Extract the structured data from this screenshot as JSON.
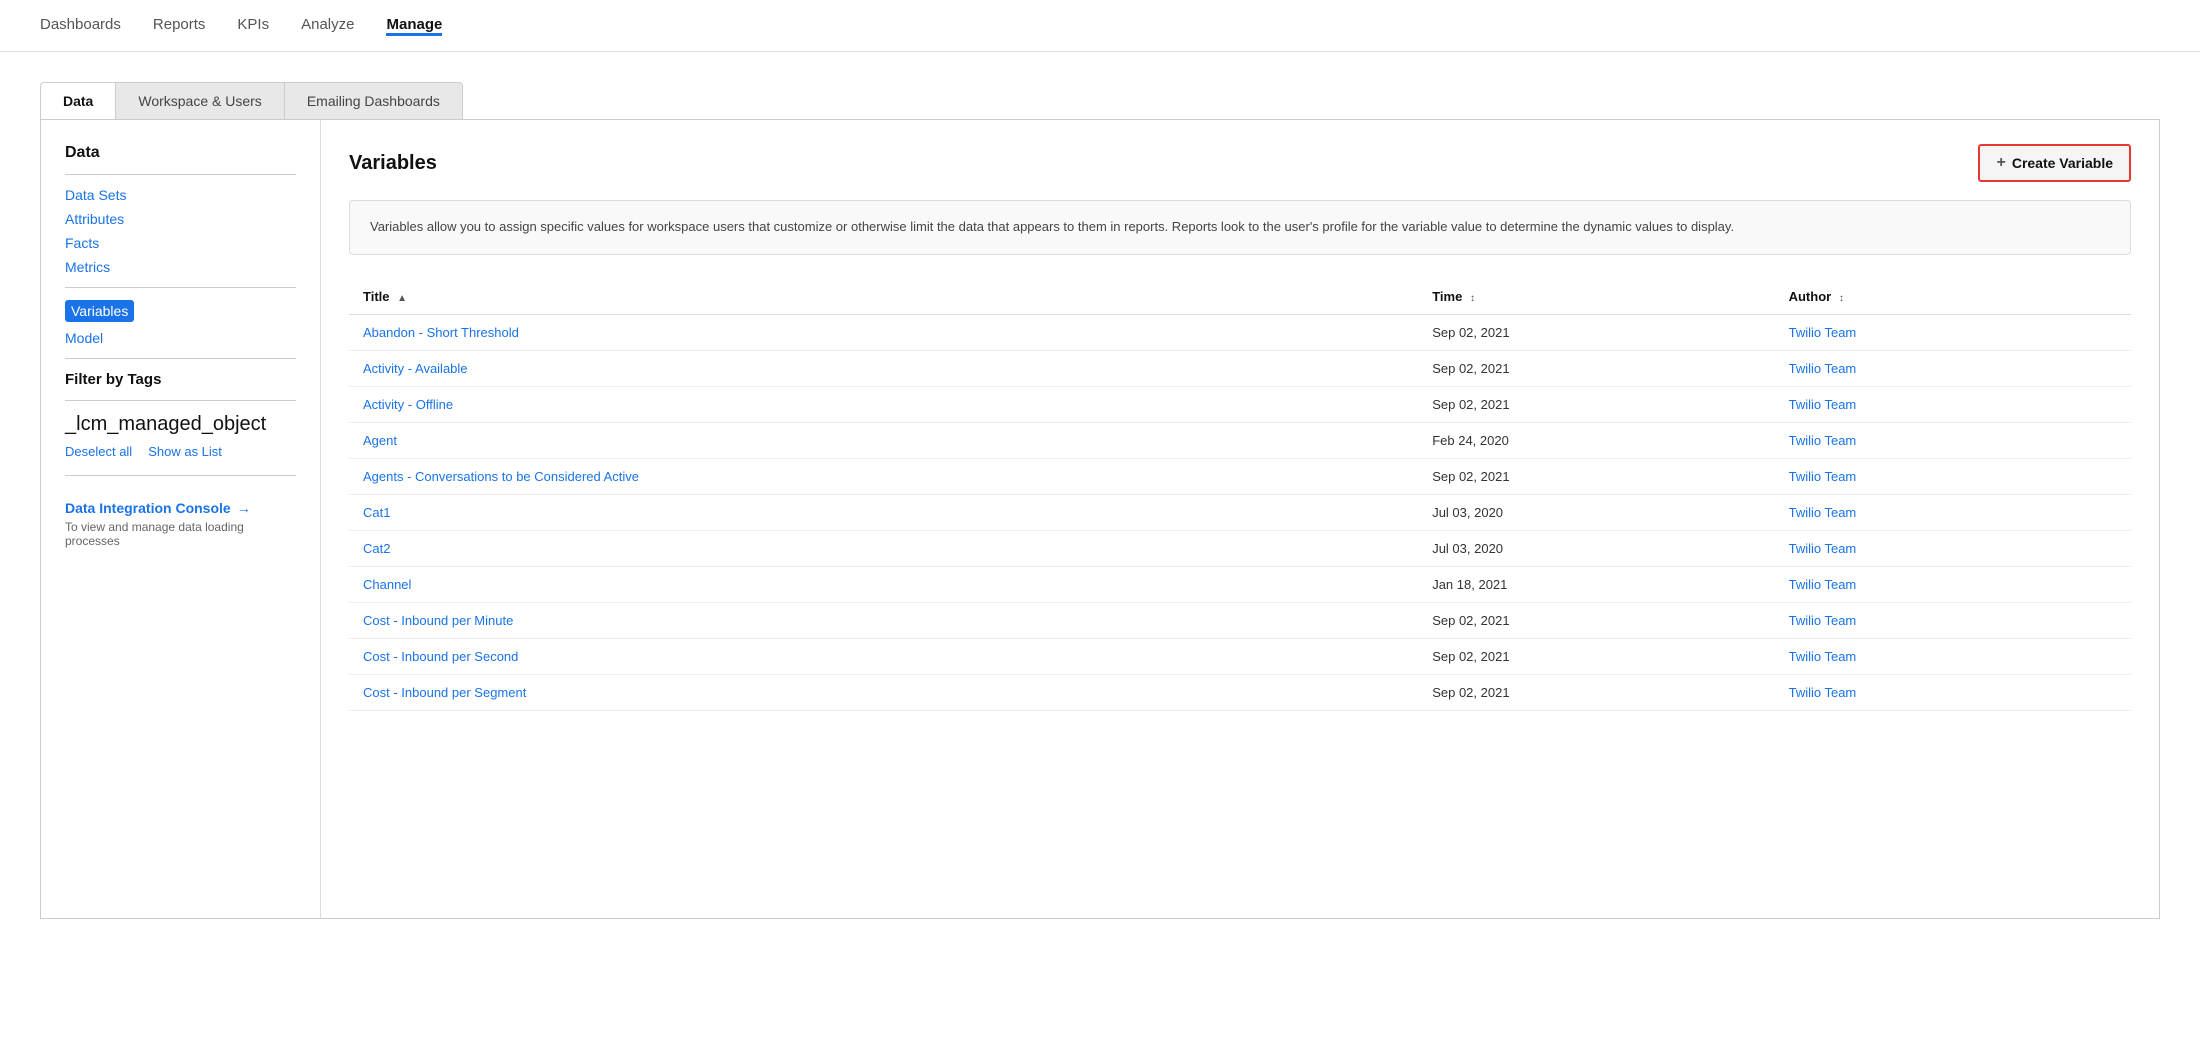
{
  "topNav": {
    "items": [
      {
        "label": "Dashboards",
        "active": false
      },
      {
        "label": "Reports",
        "active": false
      },
      {
        "label": "KPIs",
        "active": false
      },
      {
        "label": "Analyze",
        "active": false
      },
      {
        "label": "Manage",
        "active": true
      }
    ]
  },
  "tabs": [
    {
      "label": "Data",
      "active": true
    },
    {
      "label": "Workspace & Users",
      "active": false
    },
    {
      "label": "Emailing Dashboards",
      "active": false
    }
  ],
  "sidebar": {
    "dataSection": {
      "title": "Data",
      "links": [
        {
          "label": "Data Sets",
          "selected": false
        },
        {
          "label": "Attributes",
          "selected": false
        },
        {
          "label": "Facts",
          "selected": false
        },
        {
          "label": "Metrics",
          "selected": false
        }
      ]
    },
    "variablesLinks": [
      {
        "label": "Variables",
        "selected": true
      },
      {
        "label": "Model",
        "selected": false
      }
    ],
    "filterByTags": {
      "title": "Filter by Tags",
      "tagValue": "_lcm_managed_object",
      "deselectAll": "Deselect all",
      "showAsList": "Show as List"
    },
    "dataIntegration": {
      "linkLabel": "Data Integration Console",
      "arrowIcon": "→",
      "description": "To view and manage data loading processes"
    }
  },
  "main": {
    "sectionTitle": "Variables",
    "createButton": {
      "plusLabel": "+",
      "label": "Create Variable"
    },
    "infoBox": "Variables allow you to assign specific values for workspace users that customize or otherwise limit the data that appears to them in reports. Reports look to the user's profile for the variable value to determine the dynamic values to display.",
    "table": {
      "columns": [
        {
          "label": "Title",
          "sortIcon": "▲"
        },
        {
          "label": "Time",
          "sortIcon": "↕"
        },
        {
          "label": "Author",
          "sortIcon": "↕"
        }
      ],
      "rows": [
        {
          "title": "Abandon - Short Threshold",
          "time": "Sep 02, 2021",
          "author": "Twilio Team"
        },
        {
          "title": "Activity - Available",
          "time": "Sep 02, 2021",
          "author": "Twilio Team"
        },
        {
          "title": "Activity - Offline",
          "time": "Sep 02, 2021",
          "author": "Twilio Team"
        },
        {
          "title": "Agent",
          "time": "Feb 24, 2020",
          "author": "Twilio Team"
        },
        {
          "title": "Agents - Conversations to be Considered Active",
          "time": "Sep 02, 2021",
          "author": "Twilio Team"
        },
        {
          "title": "Cat1",
          "time": "Jul 03, 2020",
          "author": "Twilio Team"
        },
        {
          "title": "Cat2",
          "time": "Jul 03, 2020",
          "author": "Twilio Team"
        },
        {
          "title": "Channel",
          "time": "Jan 18, 2021",
          "author": "Twilio Team"
        },
        {
          "title": "Cost - Inbound per Minute",
          "time": "Sep 02, 2021",
          "author": "Twilio Team"
        },
        {
          "title": "Cost - Inbound per Second",
          "time": "Sep 02, 2021",
          "author": "Twilio Team"
        },
        {
          "title": "Cost - Inbound per Segment",
          "time": "Sep 02, 2021",
          "author": "Twilio Team"
        }
      ]
    }
  }
}
